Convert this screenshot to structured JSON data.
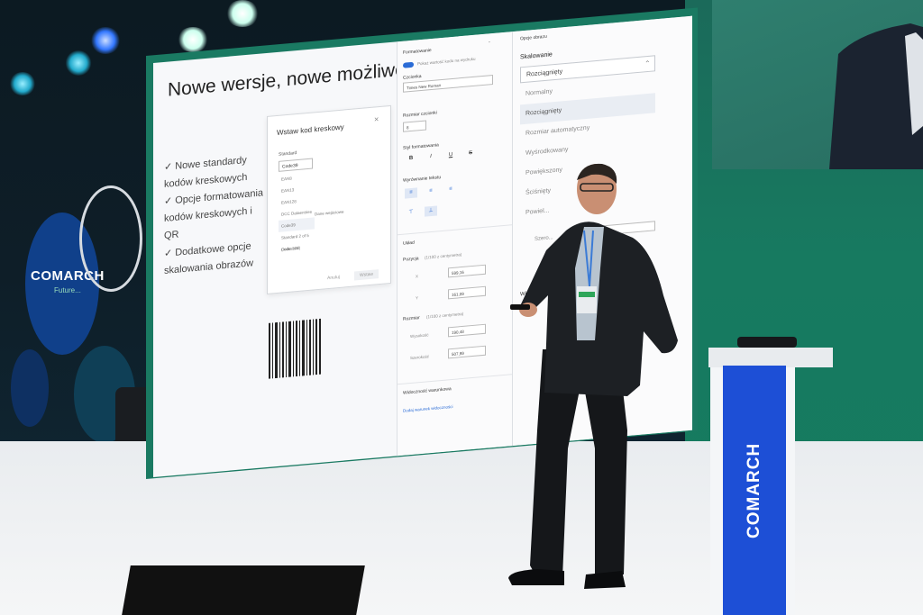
{
  "slide": {
    "title": "Nowe wersje, nowe możliwości",
    "bullets": [
      "Nowe standardy kodów kreskowych",
      "Opcje formatowania kodów kreskowych i QR",
      "Dodatkowe opcje skalowania obrazów"
    ],
    "tick": "✓",
    "dialog": {
      "title": "Wstaw kod kreskowy",
      "close": "×",
      "label": "Standard",
      "selected": "Code39",
      "options": [
        "EAN8",
        "EAN13",
        "EAN128",
        "DCC Dataentries",
        "Code39",
        "Standard 2 of 5 (Industrial)",
        "Code 128"
      ],
      "side_text": "Dane wejściowe",
      "btn_left": "Anuluj",
      "btn_right": "Wstaw"
    }
  },
  "panel_format": {
    "section": "Formatowanie",
    "toggle_label": "Pokaż wartość kodu na wydruku",
    "font_label": "Czcionka",
    "font_value": "Times New Roman",
    "size_label": "Rozmiar czcionki",
    "size_value": "8",
    "style_label": "Styl formatowania",
    "style_buttons": [
      "B",
      "I",
      "U",
      "S"
    ],
    "align_label": "Wyrównanie tekstu",
    "layout_section": "Układ",
    "position_label": "Pozycja",
    "position_hint": "(1/100 z centymetra)",
    "x_label": "X",
    "x_value": "599,16",
    "y_label": "Y",
    "y_value": "161,09",
    "size2_label": "Rozmiar",
    "size2_hint": "(1/100 z centymetra)",
    "height_label": "Wysokość",
    "height_value": "190,48",
    "width_label": "Szerokość",
    "width_value": "507,99",
    "visibility_section": "Widoczność warunkowa",
    "add_condition_link": "Dodaj warunek widoczności"
  },
  "panel_scale": {
    "header": "Opcje obrazu",
    "title": "Skalowanie",
    "selected": "Rozciągnięty",
    "options": [
      "Normalny",
      "Rozciągnięty",
      "Rozmiar automatyczny",
      "Wyśrodkowany",
      "Powiększony",
      "Ściśnięty",
      "Powiel..."
    ],
    "width_label": "Szero...",
    "width_value": "99",
    "section_w": "Wi..."
  },
  "stage": {
    "bubble_brand": "COMARCH",
    "bubble_sub": "Future..."
  },
  "podium": {
    "brand": "COMARCH",
    "color": "#1d4fd6"
  },
  "colors": {
    "stage_green": "#177a60",
    "accent_blue": "#2b6cd6"
  }
}
